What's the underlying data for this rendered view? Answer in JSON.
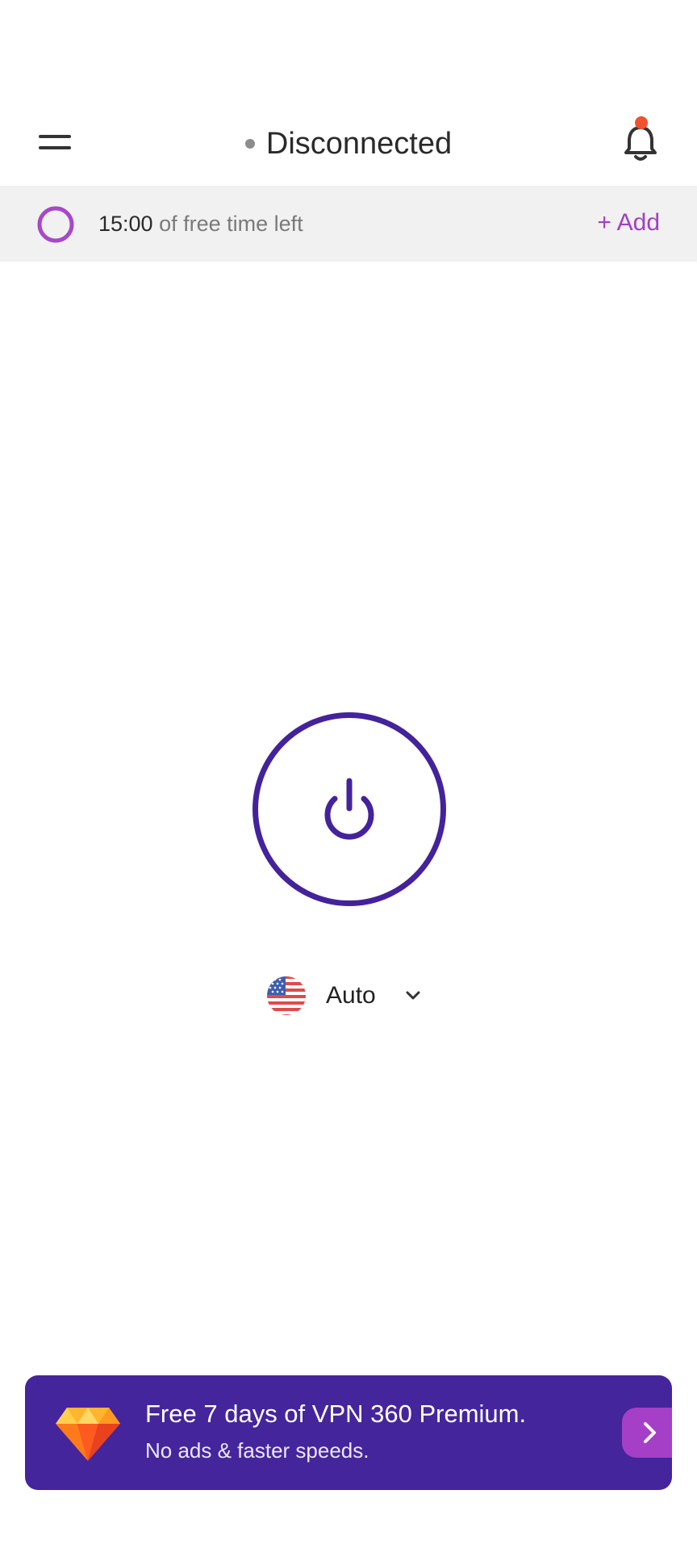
{
  "header": {
    "status_text": "Disconnected",
    "status_color": "#8c8c8c",
    "menu_icon": "hamburger-menu-icon",
    "bell_icon": "bell-icon",
    "notification_dot_color": "#f0522d"
  },
  "timebar": {
    "time_value": "15:00",
    "time_suffix": "of free time left",
    "add_label": "+ Add",
    "accent": "#a23fc4"
  },
  "power": {
    "icon": "power-icon",
    "color": "#44229c"
  },
  "location": {
    "flag_icon": "us-flag-icon",
    "label": "Auto",
    "chevron_icon": "chevron-down-icon"
  },
  "promo": {
    "title": "Free 7 days of VPN 360 Premium.",
    "subtitle": "No ads & faster speeds.",
    "gem_icon": "diamond-icon",
    "arrow_icon": "chevron-right-icon",
    "background": "#45259c",
    "button_color": "#a63fc8"
  }
}
